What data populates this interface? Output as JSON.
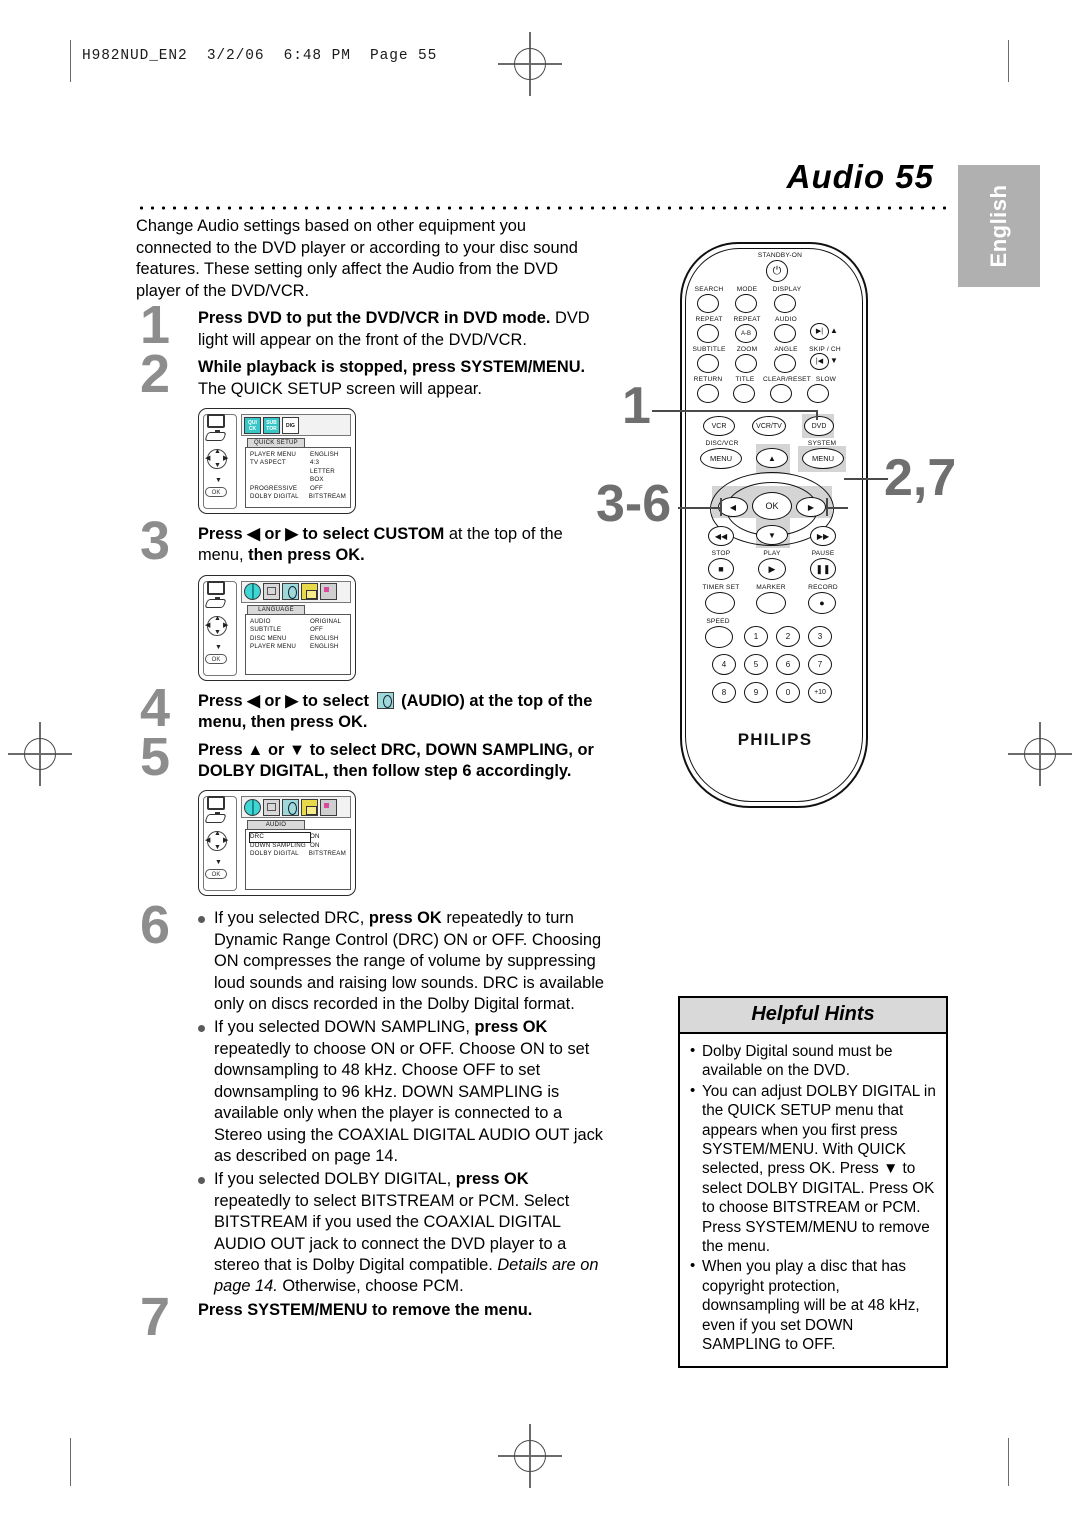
{
  "file_header": "H982NUD_EN2  3/2/06  6:48 PM  Page 55",
  "page": {
    "title": "Audio  55",
    "side_tab": "English"
  },
  "intro": "Change Audio settings based on other equipment you connected to the DVD player or according to your disc sound features. These setting only affect the Audio from the DVD player of the DVD/VCR.",
  "steps": [
    {
      "num": "1",
      "bold": "Press DVD to put the DVD/VCR in DVD mode.",
      "rest": "DVD light will appear on the front of the DVD/VCR."
    },
    {
      "num": "2",
      "bold": "While playback is stopped, press SYSTEM/MENU.",
      "rest": "The QUICK SETUP screen will appear."
    },
    {
      "num": "3",
      "bold_a": "Press ◀ or ▶ to select CUSTOM",
      "mid": " at the top of the menu, ",
      "bold_b": "then press OK."
    },
    {
      "num": "4",
      "bold_a": "Press ◀ or ▶ to select",
      "bold_b": "(AUDIO) at the top of the menu, then press OK."
    },
    {
      "num": "5",
      "bold": "Press ▲ or ▼ to select DRC, DOWN SAMPLING, or DOLBY DIGITAL, then follow step 6 accordingly."
    },
    {
      "num": "6",
      "bullets": [
        {
          "pre": "If you selected DRC, ",
          "bold": "press OK",
          "post": " repeatedly to turn Dynamic Range Control (DRC) ON or OFF. Choosing ON compresses the range of volume by suppressing loud sounds and raising low sounds. DRC is available only on discs recorded in the Dolby Digital format."
        },
        {
          "pre": "If you selected DOWN SAMPLING, ",
          "bold": "press OK",
          "post": " repeatedly to choose ON or OFF. Choose ON to set downsampling to 48 kHz. Choose OFF to set downsampling to 96 kHz. DOWN SAMPLING is available only when the player is connected to a Stereo using the COAXIAL DIGITAL AUDIO OUT jack as described on page 14."
        },
        {
          "pre": "If you selected DOLBY DIGITAL, ",
          "bold": "press OK",
          "post": " repeatedly to select BITSTREAM or PCM. Select BITSTREAM if you used the COAXIAL DIGITAL AUDIO OUT jack to connect the DVD player to a stereo that is Dolby Digital compatible. ",
          "italic": "Details are on page 14.",
          "tail": " Otherwise, choose PCM."
        }
      ]
    },
    {
      "num": "7",
      "bold": "Press SYSTEM/MENU to remove the menu."
    }
  ],
  "osd_screens": [
    {
      "id": "quick-setup",
      "tab": "QUICK SETUP",
      "icons": [
        "quick-setup-icon",
        "sub-tab-icon",
        "digital-icon"
      ],
      "rows": [
        {
          "key": "PLAYER MENU",
          "value": "ENGLISH",
          "selected": false
        },
        {
          "key": "TV ASPECT",
          "value": "4:3 LETTER BOX",
          "selected": false
        },
        {
          "key": "PROGRESSIVE",
          "value": "OFF",
          "selected": false
        },
        {
          "key": "DOLBY DIGITAL",
          "value": "BITSTREAM",
          "selected": false
        }
      ]
    },
    {
      "id": "language",
      "tab": "LANGUAGE",
      "icons": [
        "globe-icon",
        "screen-icon",
        "audio-icon",
        "lock-icon",
        "custom-icon"
      ],
      "rows": [
        {
          "key": "AUDIO",
          "value": "ORIGINAL",
          "selected": false
        },
        {
          "key": "SUBTITLE",
          "value": "OFF",
          "selected": false
        },
        {
          "key": "DISC MENU",
          "value": "ENGLISH",
          "selected": false
        },
        {
          "key": "PLAYER MENU",
          "value": "ENGLISH",
          "selected": false
        }
      ]
    },
    {
      "id": "audio",
      "tab": "AUDIO",
      "icons": [
        "globe-icon",
        "screen-icon",
        "audio-icon",
        "lock-icon",
        "custom-icon"
      ],
      "rows": [
        {
          "key": "DRC",
          "value": "ON",
          "selected": true
        },
        {
          "key": "DOWN SAMPLING",
          "value": "ON",
          "selected": false
        },
        {
          "key": "DOLBY DIGITAL",
          "value": "BITSTREAM",
          "selected": false
        }
      ]
    }
  ],
  "remote": {
    "brand": "PHILIPS",
    "standby_label": "STANDBY-ON",
    "callouts": [
      {
        "label": "1",
        "target": "dvd-button"
      },
      {
        "label": "2,7",
        "target": "system-menu-button"
      },
      {
        "label": "3-6",
        "target": "navigation-pad"
      }
    ],
    "rows": [
      {
        "labels": [
          "SEARCH",
          "MODE",
          "DISPLAY"
        ]
      },
      {
        "labels": [
          "REPEAT",
          "REPEAT",
          "AUDIO"
        ],
        "extra": "A-B"
      },
      {
        "labels": [
          "SUBTITLE",
          "ZOOM",
          "ANGLE",
          "SKIP / CH"
        ]
      },
      {
        "labels": [
          "RETURN",
          "TITLE",
          "CLEAR/RESET",
          "SLOW"
        ]
      },
      {
        "labels": [
          "VCR",
          "VCR/TV",
          "DVD"
        ]
      },
      {
        "labels": [
          "DISC/VCR",
          "SYSTEM"
        ],
        "menus": [
          "MENU",
          "MENU"
        ]
      },
      {
        "labels": [
          "STOP",
          "PLAY",
          "PAUSE"
        ]
      },
      {
        "labels": [
          "TIMER SET",
          "MARKER",
          "RECORD"
        ]
      },
      {
        "labels": [
          "SPEED"
        ]
      }
    ],
    "ok_label": "OK",
    "keypad": [
      "1",
      "2",
      "3",
      "4",
      "5",
      "6",
      "7",
      "8",
      "9",
      "0",
      "+10"
    ]
  },
  "hints": {
    "title": "Helpful Hints",
    "items": [
      "Dolby Digital sound must be available on the DVD.",
      "You can adjust DOLBY DIGITAL in the QUICK SETUP menu that appears when you first press SYSTEM/MENU. With QUICK selected, press OK. Press ▼ to select DOLBY DIGITAL. Press OK to choose BITSTREAM or PCM. Press SYSTEM/MENU to remove the menu.",
      "When you play a disc that has copyright protection, downsampling will be at 48 kHz, even if you set DOWN SAMPLING to OFF."
    ]
  }
}
